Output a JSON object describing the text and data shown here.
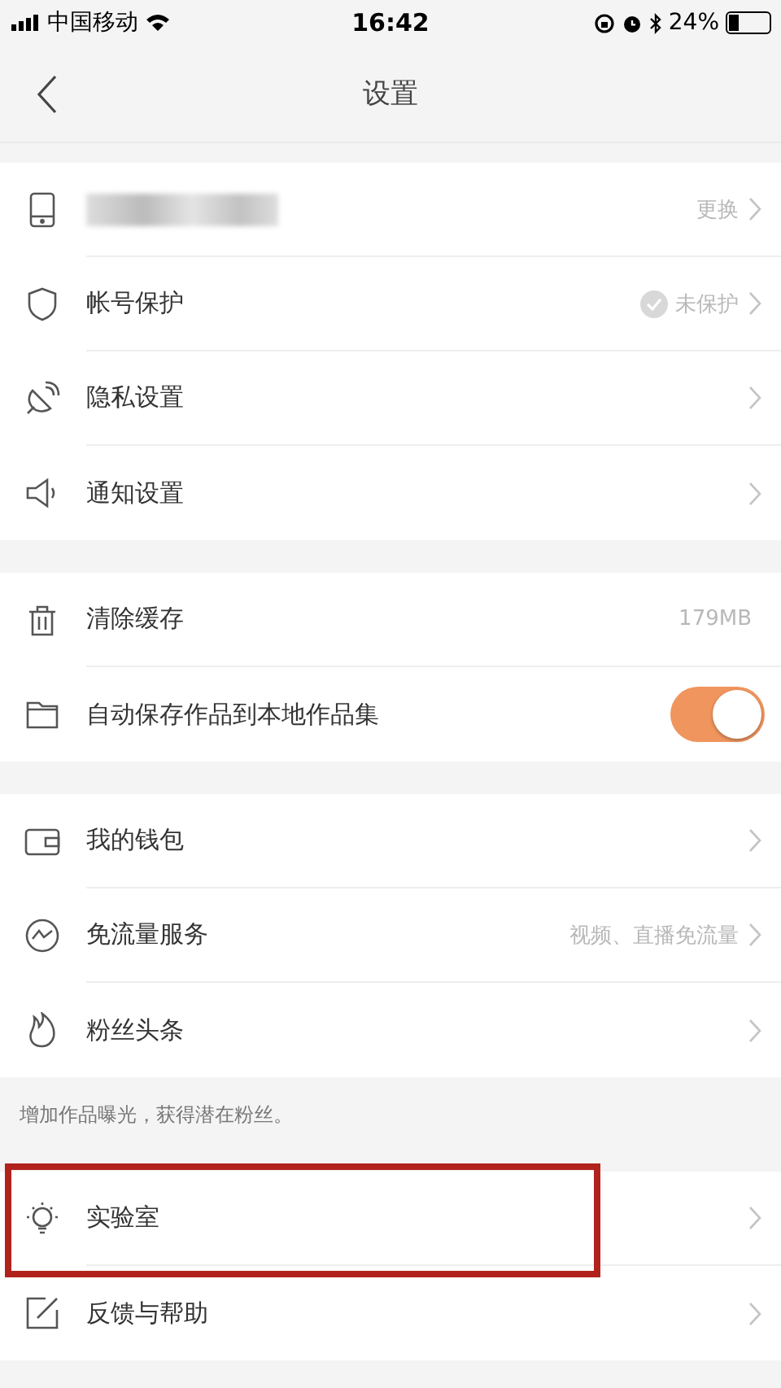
{
  "status_bar": {
    "carrier": "中国移动",
    "time": "16:42",
    "battery": "24%"
  },
  "nav": {
    "title": "设置"
  },
  "sections": [
    {
      "items": [
        {
          "kind": "account",
          "value": "更换",
          "highlighted": false
        },
        {
          "kind": "status",
          "label": "帐号保护",
          "value": "未保护",
          "protected": false,
          "highlighted": false
        },
        {
          "kind": "link",
          "label": "隐私设置",
          "highlighted": false
        },
        {
          "kind": "link",
          "label": "通知设置",
          "highlighted": false
        }
      ]
    },
    {
      "items": [
        {
          "kind": "info",
          "label": "清除缓存",
          "value": "179MB",
          "highlighted": false
        },
        {
          "kind": "toggle",
          "label": "自动保存作品到本地作品集",
          "on": true,
          "highlighted": false
        }
      ]
    },
    {
      "items": [
        {
          "kind": "link",
          "label": "我的钱包",
          "highlighted": false
        },
        {
          "kind": "link",
          "label": "免流量服务",
          "value": "视频、直播免流量",
          "highlighted": false
        },
        {
          "kind": "link",
          "label": "粉丝头条",
          "highlighted": false
        }
      ],
      "note": "增加作品曝光，获得潜在粉丝。"
    },
    {
      "items": [
        {
          "kind": "link",
          "label": "实验室",
          "highlighted": true
        },
        {
          "kind": "link",
          "label": "反馈与帮助",
          "highlighted": false
        }
      ]
    }
  ]
}
